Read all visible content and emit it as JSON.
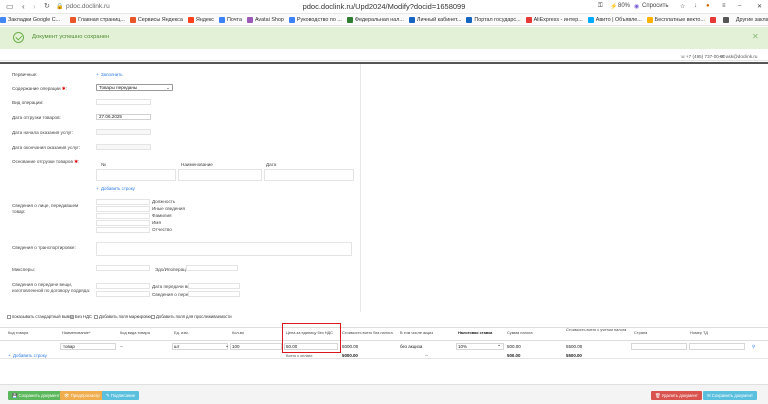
{
  "browser": {
    "domain": "pdoc.doclink.ru",
    "url": "pdoc.doclink.ru/Upd2024/Modify?docid=1658099",
    "battery": "80%",
    "ask": "Спросить",
    "bookmarks": [
      {
        "label": "Закладки Google C...",
        "color": "#4285f4"
      },
      {
        "label": "Главная страниц...",
        "color": "#e8562a"
      },
      {
        "label": "Сервисы Яндекса",
        "color": "#e8562a"
      },
      {
        "label": "Яндекс",
        "color": "#fc3f1d"
      },
      {
        "label": "Почта",
        "color": "#3b82f6"
      },
      {
        "label": "Avatai Shop",
        "color": "#9b59b6"
      },
      {
        "label": "Руководство по ...",
        "color": "#3b82f6"
      },
      {
        "label": "Федеральная нал...",
        "color": "#2e7d32"
      },
      {
        "label": "Личный кабинет...",
        "color": "#1565c0"
      },
      {
        "label": "Портал государс...",
        "color": "#1565c0"
      },
      {
        "label": "AliExpress - интер...",
        "color": "#e53935"
      },
      {
        "label": "Авито | Объявле...",
        "color": "#00aaff"
      },
      {
        "label": "Бесплатные векто...",
        "color": "#ffb300"
      },
      {
        "label": "",
        "color": "#e53935"
      },
      {
        "label": "",
        "color": "#555555"
      }
    ],
    "other_bookmarks": "Другие закладки"
  },
  "notice": {
    "text": "Документ успешно сохранен"
  },
  "top_info": {
    "phone": "+7 (495) 737-00-00",
    "email": "ask@doclink.ru"
  },
  "form": {
    "primary_label": "Первичные:",
    "fill_link": "Заполнить",
    "content_label": "Содержание операции",
    "content_value": "Товары переданы",
    "op_type_label": "Вид операции:",
    "ship_date_label": "Дата отгрузки товаров:",
    "ship_date_value": "27.06.2025",
    "service_start_label": "Дата начала оказания услуг:",
    "service_end_label": "Дата окончания оказания услуг:",
    "basis_label": "Основание отгрузки товаров",
    "basis_col_num": "№",
    "basis_col_name": "Наименование",
    "basis_col_date": "Дата",
    "add_row_link": "Добавить строку",
    "person_label": "Сведения о лице, передавшем товар:",
    "person_fields": [
      "Должность",
      "Иные сведения",
      "Фамилия",
      "Имя",
      "Отчество"
    ],
    "transport_label": "Сведения о транспортировке:",
    "cargo_label": "Миксперы:",
    "waybill_label": "Эдо/Ипоперац:",
    "transfer_label": "Сведения о передаче вещи, изготовленной по договору подряда:",
    "transfer_date_label": "Дата передачи вещи",
    "transfer_info_label": "Сведения о передаче"
  },
  "table": {
    "options": [
      "показывать стандартный вывод",
      "Без НДС",
      "Добавить поля маркировки",
      "Добавить поля для прослеживаемости"
    ],
    "headers": [
      "Код товара",
      "Наименование*",
      "Код вида товара",
      "Ед. изм.",
      "Кол-во",
      "Цена за единицу без НДС",
      "Стоимость всего без налога",
      "В том числе акциз",
      "Налоговая ставка",
      "Сумма налога",
      "Стоимость всего с учетом налога",
      "Страна",
      "Номер ТД"
    ],
    "row": {
      "name": "товар",
      "kind": "--",
      "unit": "шт",
      "qty": "100",
      "price": "50.00",
      "cost_no_tax": "5000.00",
      "excise": "без акциза",
      "rate": "10%",
      "tax": "500.00",
      "total": "5500.00"
    },
    "add_row_link": "Добавить строку",
    "sum_label": "Всего к оплате",
    "sum_no_tax": "5000.00",
    "sum_tax": "500.00",
    "sum_total": "5500.00",
    "sum_dash": "--"
  },
  "footer": {
    "save": "Сохранить документ",
    "preview": "Предпросмотр",
    "sign": "Подписание",
    "delete": "Удалить документ",
    "send": "Сохранить документ"
  }
}
